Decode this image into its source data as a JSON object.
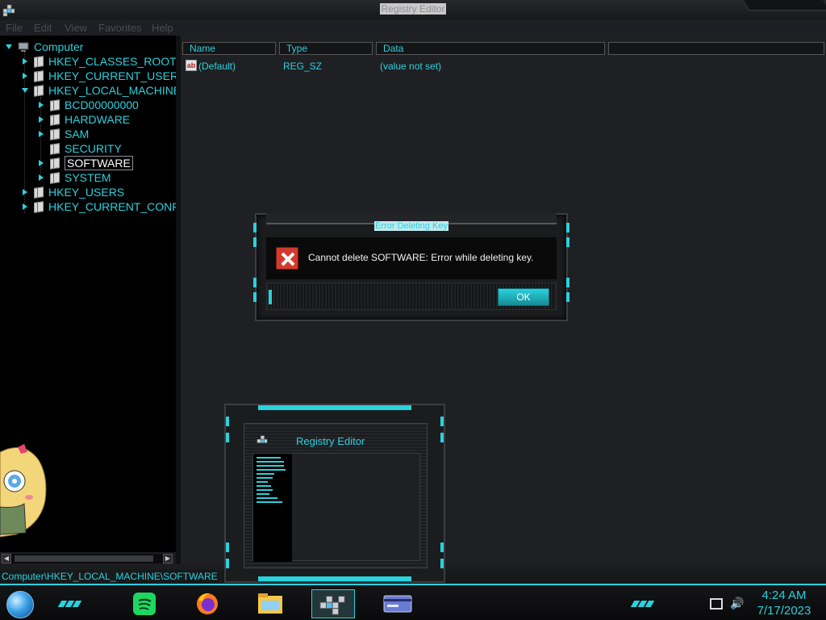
{
  "window": {
    "title": "Registry Editor"
  },
  "menu": [
    "File",
    "Edit",
    "View",
    "Favorites",
    "Help"
  ],
  "tree": {
    "root": "Computer",
    "items": [
      {
        "label": "HKEY_CLASSES_ROOT",
        "level": 1,
        "expanded": false
      },
      {
        "label": "HKEY_CURRENT_USER",
        "level": 1,
        "expanded": false
      },
      {
        "label": "HKEY_LOCAL_MACHINE",
        "level": 1,
        "expanded": true
      },
      {
        "label": "BCD00000000",
        "level": 2,
        "expanded": false
      },
      {
        "label": "HARDWARE",
        "level": 2,
        "expanded": false
      },
      {
        "label": "SAM",
        "level": 2,
        "expanded": false
      },
      {
        "label": "SECURITY",
        "level": 2,
        "expanded": false,
        "leaf": true
      },
      {
        "label": "SOFTWARE",
        "level": 2,
        "expanded": false,
        "selected": true
      },
      {
        "label": "SYSTEM",
        "level": 2,
        "expanded": false
      },
      {
        "label": "HKEY_USERS",
        "level": 1,
        "expanded": false
      },
      {
        "label": "HKEY_CURRENT_CONFI",
        "level": 1,
        "expanded": false
      }
    ]
  },
  "list": {
    "columns": [
      "Name",
      "Type",
      "Data"
    ],
    "rows": [
      {
        "name": "(Default)",
        "type": "REG_SZ",
        "data": "(value not set)",
        "icon": "string-value-icon"
      }
    ]
  },
  "status": {
    "path": "Computer\\HKEY_LOCAL_MACHINE\\SOFTWARE"
  },
  "dialog": {
    "title": "Error Deleting Key",
    "message": "Cannot delete SOFTWARE:  Error while deleting key.",
    "ok_label": "OK",
    "icon": "error-icon"
  },
  "thumbnail": {
    "title": "Registry Editor"
  },
  "taskbar": {
    "apps": [
      {
        "name": "spotify",
        "icon": "spotify-icon"
      },
      {
        "name": "firefox",
        "icon": "firefox-icon"
      },
      {
        "name": "file-explorer",
        "icon": "folder-icon"
      },
      {
        "name": "registry-editor",
        "icon": "registry-icon",
        "active": true
      },
      {
        "name": "other-app",
        "icon": "card-icon"
      }
    ],
    "time": "4:24 AM",
    "date": "7/17/2023"
  },
  "colors": {
    "accent": "#2ad1de",
    "background": "#1c1d1f",
    "error": "#d23a2c"
  }
}
